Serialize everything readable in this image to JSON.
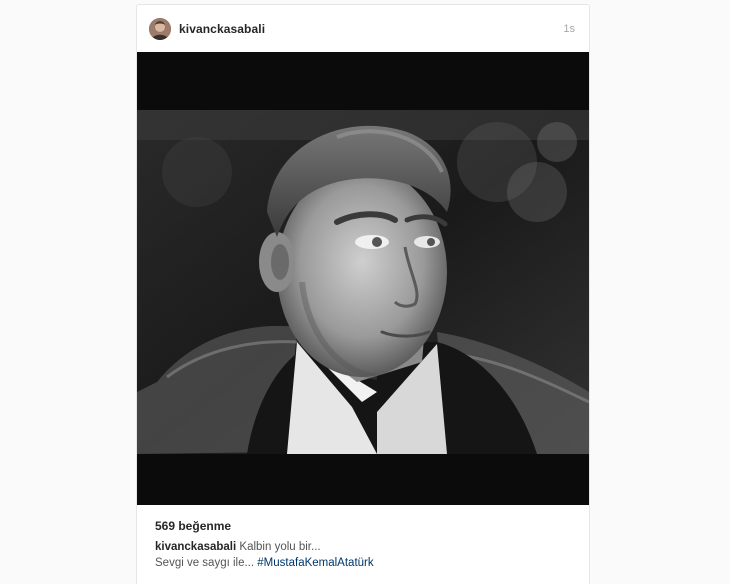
{
  "post": {
    "username": "kivanckasabali",
    "timestamp": "1s",
    "likes": "569 beğenme",
    "caption": {
      "author": "kivanckasabali",
      "line1": "Kalbin yolu bir...",
      "line2": "Sevgi ve saygı ile...",
      "hashtag": "#MustafaKemalAtatürk"
    },
    "avatar_icon": "user-avatar-icon",
    "media_icon": "portrait-photo"
  }
}
